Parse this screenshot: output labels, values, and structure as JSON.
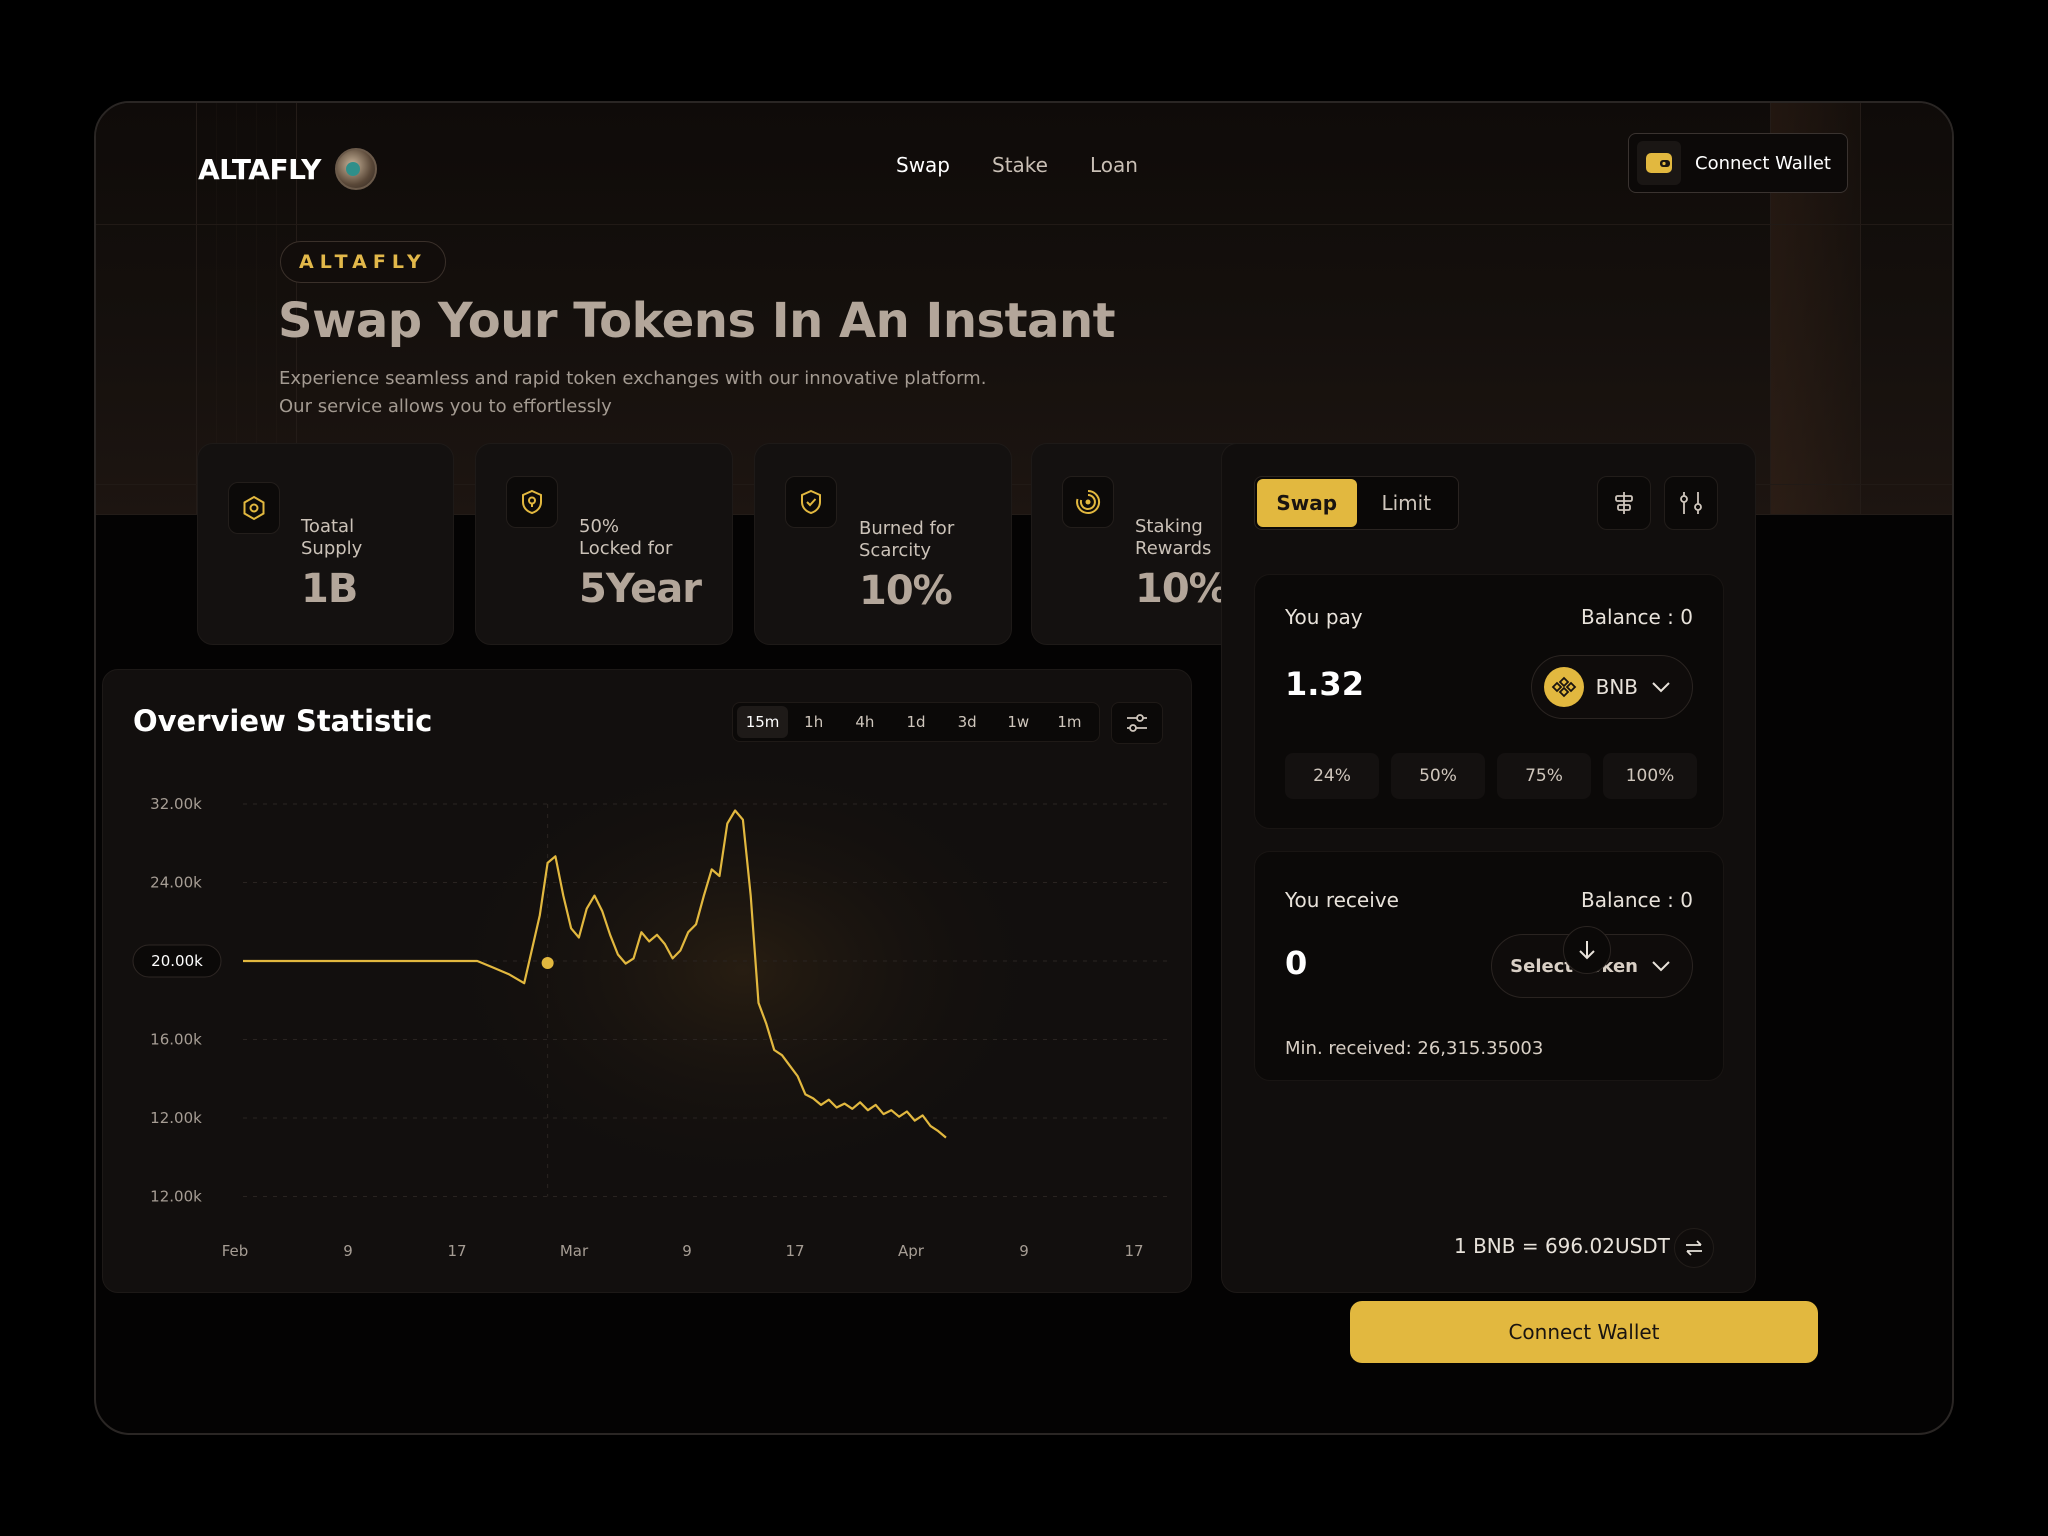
{
  "brand": {
    "name": "ALTAFLY"
  },
  "nav": {
    "items": [
      "Swap",
      "Stake",
      "Loan"
    ],
    "active": "Swap"
  },
  "header": {
    "connect_wallet": "Connect Wallet"
  },
  "hero": {
    "badge": "ALTAFLY",
    "title": "Swap Your Tokens In An Instant",
    "subtitle_line1": "Experience seamless and rapid token exchanges with our innovative platform.",
    "subtitle_line2": "Our service allows you to effortlessly"
  },
  "stats": [
    {
      "icon": "hexagon-icon",
      "label": "Toatal\nSupply",
      "value": "1B"
    },
    {
      "icon": "shield-lock-icon",
      "label": "50%\nLocked for",
      "value": "5Year"
    },
    {
      "icon": "shield-check-icon",
      "label": "Burned for\nScarcity",
      "value": "10%"
    },
    {
      "icon": "spinner-icon",
      "label": "Staking\nRewards",
      "value": "10%"
    }
  ],
  "chart_data": {
    "type": "line",
    "title": "Overview Statistic",
    "y_ticks": [
      "32.00k",
      "24.00k",
      "20.00k",
      "16.00k",
      "12.00k",
      "12.00k"
    ],
    "x_ticks": [
      "Feb",
      "9",
      "17",
      "Mar",
      "9",
      "17",
      "Apr",
      "9",
      "17"
    ],
    "highlight_y_label": "20.00k",
    "timeframes": [
      "15m",
      "1h",
      "4h",
      "1d",
      "3d",
      "1w",
      "1m"
    ],
    "active_timeframe": "15m",
    "line_color": "#e2b83f",
    "grid": "dashed",
    "series": [
      {
        "x": [
          0,
          0.5,
          1,
          1.5,
          2,
          2.5,
          3,
          3.2,
          3.4,
          3.6,
          3.8,
          3.9,
          4.0,
          4.1,
          4.2,
          4.3,
          4.4,
          4.5,
          4.6,
          4.7,
          4.8,
          4.9,
          5.0,
          5.1,
          5.2,
          5.3,
          5.4,
          5.5,
          5.6,
          5.7,
          5.8,
          5.9,
          6.0,
          6.1,
          6.2,
          6.3,
          6.4,
          6.5,
          6.6,
          6.7,
          6.8,
          6.9,
          7.0,
          7.1,
          7.2,
          7.3,
          7.4,
          7.5,
          7.6,
          7.7,
          7.8,
          7.9,
          8.0,
          8.1,
          8.2,
          8.3,
          8.4,
          8.5,
          8.6,
          8.7,
          8.8,
          8.9,
          9.0
        ],
        "y": [
          20000,
          20000,
          20000,
          20000,
          20000,
          20000,
          20000,
          19500,
          19000,
          18300,
          23500,
          27500,
          28000,
          25000,
          22500,
          21800,
          24000,
          25000,
          23800,
          22000,
          20500,
          19800,
          20200,
          22200,
          21500,
          22000,
          21300,
          20200,
          20800,
          22200,
          22800,
          25000,
          27000,
          26500,
          30500,
          31500,
          30800,
          25000,
          16800,
          15200,
          13200,
          12800,
          12000,
          11200,
          9800,
          9500,
          9000,
          9400,
          8800,
          9100,
          8700,
          9200,
          8600,
          9000,
          8300,
          8600,
          8100,
          8500,
          7800,
          8200,
          7400,
          7000,
          6500
        ]
      }
    ],
    "highlight_point": {
      "x": 3.9,
      "y": 20000
    }
  },
  "swap": {
    "tabs": [
      "Swap",
      "Limit"
    ],
    "active_tab": "Swap",
    "pay": {
      "label": "You pay",
      "balance": "Balance : 0",
      "amount": "1.32",
      "token": "BNB"
    },
    "percent_buttons": [
      "24%",
      "50%",
      "75%",
      "100%"
    ],
    "receive": {
      "label": "You receive",
      "balance": "Balance : 0",
      "amount": "0",
      "token": "Select Token",
      "min_received": "Min. received: 26,315.35003"
    },
    "rate": "1 BNB = 696.02USDT",
    "connect_wallet": "Connect Wallet"
  },
  "colors": {
    "accent": "#e2b83f",
    "background": "#040303",
    "card": "#141110"
  }
}
